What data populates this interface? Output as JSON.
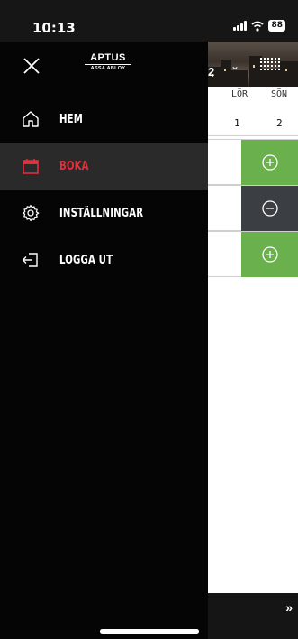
{
  "status_bar": {
    "time": "10:13",
    "battery": "88"
  },
  "drawer": {
    "logo": {
      "brand": "APTUS",
      "sub": "ASSA ABLOY"
    },
    "items": [
      {
        "label": "HEM",
        "icon": "home-icon",
        "active": false
      },
      {
        "label": "BOKA",
        "icon": "calendar-icon",
        "active": true
      },
      {
        "label": "INSTÄLLNINGAR",
        "icon": "gear-icon",
        "active": false
      },
      {
        "label": "LOGGA UT",
        "icon": "logout-icon",
        "active": false
      }
    ]
  },
  "calendar": {
    "year_fragment": "2",
    "days": [
      {
        "name": "LÖR",
        "num": "1"
      },
      {
        "name": "SÖN",
        "num": "2"
      }
    ],
    "slots": [
      "free",
      "booked",
      "free"
    ],
    "next_label": "»"
  },
  "colors": {
    "accent_red": "#e0303c",
    "free_green": "#6ab04c",
    "booked_dark": "#3b3f43"
  }
}
